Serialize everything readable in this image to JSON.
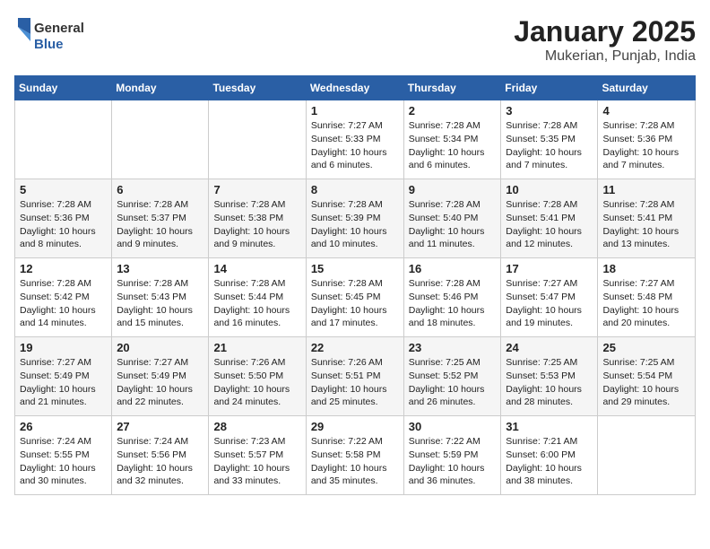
{
  "logo": {
    "general": "General",
    "blue": "Blue"
  },
  "title": "January 2025",
  "subtitle": "Mukerian, Punjab, India",
  "days_of_week": [
    "Sunday",
    "Monday",
    "Tuesday",
    "Wednesday",
    "Thursday",
    "Friday",
    "Saturday"
  ],
  "weeks": [
    [
      {
        "num": "",
        "sunrise": "",
        "sunset": "",
        "daylight": ""
      },
      {
        "num": "",
        "sunrise": "",
        "sunset": "",
        "daylight": ""
      },
      {
        "num": "",
        "sunrise": "",
        "sunset": "",
        "daylight": ""
      },
      {
        "num": "1",
        "sunrise": "Sunrise: 7:27 AM",
        "sunset": "Sunset: 5:33 PM",
        "daylight": "Daylight: 10 hours and 6 minutes."
      },
      {
        "num": "2",
        "sunrise": "Sunrise: 7:28 AM",
        "sunset": "Sunset: 5:34 PM",
        "daylight": "Daylight: 10 hours and 6 minutes."
      },
      {
        "num": "3",
        "sunrise": "Sunrise: 7:28 AM",
        "sunset": "Sunset: 5:35 PM",
        "daylight": "Daylight: 10 hours and 7 minutes."
      },
      {
        "num": "4",
        "sunrise": "Sunrise: 7:28 AM",
        "sunset": "Sunset: 5:36 PM",
        "daylight": "Daylight: 10 hours and 7 minutes."
      }
    ],
    [
      {
        "num": "5",
        "sunrise": "Sunrise: 7:28 AM",
        "sunset": "Sunset: 5:36 PM",
        "daylight": "Daylight: 10 hours and 8 minutes."
      },
      {
        "num": "6",
        "sunrise": "Sunrise: 7:28 AM",
        "sunset": "Sunset: 5:37 PM",
        "daylight": "Daylight: 10 hours and 9 minutes."
      },
      {
        "num": "7",
        "sunrise": "Sunrise: 7:28 AM",
        "sunset": "Sunset: 5:38 PM",
        "daylight": "Daylight: 10 hours and 9 minutes."
      },
      {
        "num": "8",
        "sunrise": "Sunrise: 7:28 AM",
        "sunset": "Sunset: 5:39 PM",
        "daylight": "Daylight: 10 hours and 10 minutes."
      },
      {
        "num": "9",
        "sunrise": "Sunrise: 7:28 AM",
        "sunset": "Sunset: 5:40 PM",
        "daylight": "Daylight: 10 hours and 11 minutes."
      },
      {
        "num": "10",
        "sunrise": "Sunrise: 7:28 AM",
        "sunset": "Sunset: 5:41 PM",
        "daylight": "Daylight: 10 hours and 12 minutes."
      },
      {
        "num": "11",
        "sunrise": "Sunrise: 7:28 AM",
        "sunset": "Sunset: 5:41 PM",
        "daylight": "Daylight: 10 hours and 13 minutes."
      }
    ],
    [
      {
        "num": "12",
        "sunrise": "Sunrise: 7:28 AM",
        "sunset": "Sunset: 5:42 PM",
        "daylight": "Daylight: 10 hours and 14 minutes."
      },
      {
        "num": "13",
        "sunrise": "Sunrise: 7:28 AM",
        "sunset": "Sunset: 5:43 PM",
        "daylight": "Daylight: 10 hours and 15 minutes."
      },
      {
        "num": "14",
        "sunrise": "Sunrise: 7:28 AM",
        "sunset": "Sunset: 5:44 PM",
        "daylight": "Daylight: 10 hours and 16 minutes."
      },
      {
        "num": "15",
        "sunrise": "Sunrise: 7:28 AM",
        "sunset": "Sunset: 5:45 PM",
        "daylight": "Daylight: 10 hours and 17 minutes."
      },
      {
        "num": "16",
        "sunrise": "Sunrise: 7:28 AM",
        "sunset": "Sunset: 5:46 PM",
        "daylight": "Daylight: 10 hours and 18 minutes."
      },
      {
        "num": "17",
        "sunrise": "Sunrise: 7:27 AM",
        "sunset": "Sunset: 5:47 PM",
        "daylight": "Daylight: 10 hours and 19 minutes."
      },
      {
        "num": "18",
        "sunrise": "Sunrise: 7:27 AM",
        "sunset": "Sunset: 5:48 PM",
        "daylight": "Daylight: 10 hours and 20 minutes."
      }
    ],
    [
      {
        "num": "19",
        "sunrise": "Sunrise: 7:27 AM",
        "sunset": "Sunset: 5:49 PM",
        "daylight": "Daylight: 10 hours and 21 minutes."
      },
      {
        "num": "20",
        "sunrise": "Sunrise: 7:27 AM",
        "sunset": "Sunset: 5:49 PM",
        "daylight": "Daylight: 10 hours and 22 minutes."
      },
      {
        "num": "21",
        "sunrise": "Sunrise: 7:26 AM",
        "sunset": "Sunset: 5:50 PM",
        "daylight": "Daylight: 10 hours and 24 minutes."
      },
      {
        "num": "22",
        "sunrise": "Sunrise: 7:26 AM",
        "sunset": "Sunset: 5:51 PM",
        "daylight": "Daylight: 10 hours and 25 minutes."
      },
      {
        "num": "23",
        "sunrise": "Sunrise: 7:25 AM",
        "sunset": "Sunset: 5:52 PM",
        "daylight": "Daylight: 10 hours and 26 minutes."
      },
      {
        "num": "24",
        "sunrise": "Sunrise: 7:25 AM",
        "sunset": "Sunset: 5:53 PM",
        "daylight": "Daylight: 10 hours and 28 minutes."
      },
      {
        "num": "25",
        "sunrise": "Sunrise: 7:25 AM",
        "sunset": "Sunset: 5:54 PM",
        "daylight": "Daylight: 10 hours and 29 minutes."
      }
    ],
    [
      {
        "num": "26",
        "sunrise": "Sunrise: 7:24 AM",
        "sunset": "Sunset: 5:55 PM",
        "daylight": "Daylight: 10 hours and 30 minutes."
      },
      {
        "num": "27",
        "sunrise": "Sunrise: 7:24 AM",
        "sunset": "Sunset: 5:56 PM",
        "daylight": "Daylight: 10 hours and 32 minutes."
      },
      {
        "num": "28",
        "sunrise": "Sunrise: 7:23 AM",
        "sunset": "Sunset: 5:57 PM",
        "daylight": "Daylight: 10 hours and 33 minutes."
      },
      {
        "num": "29",
        "sunrise": "Sunrise: 7:22 AM",
        "sunset": "Sunset: 5:58 PM",
        "daylight": "Daylight: 10 hours and 35 minutes."
      },
      {
        "num": "30",
        "sunrise": "Sunrise: 7:22 AM",
        "sunset": "Sunset: 5:59 PM",
        "daylight": "Daylight: 10 hours and 36 minutes."
      },
      {
        "num": "31",
        "sunrise": "Sunrise: 7:21 AM",
        "sunset": "Sunset: 6:00 PM",
        "daylight": "Daylight: 10 hours and 38 minutes."
      },
      {
        "num": "",
        "sunrise": "",
        "sunset": "",
        "daylight": ""
      }
    ]
  ]
}
